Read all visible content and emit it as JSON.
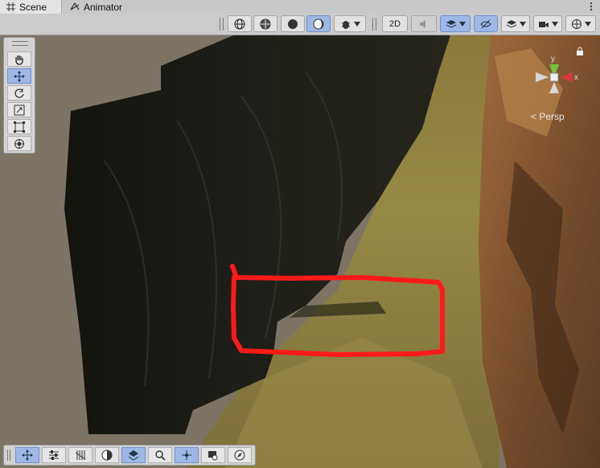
{
  "tabs": [
    {
      "label": "Scene",
      "icon": "grid-icon",
      "active": true
    },
    {
      "label": "Animator",
      "icon": "animator-icon",
      "active": false
    }
  ],
  "toolbar": {
    "mode_2d_label": "2D",
    "buttons": [
      "wireframe-globe-icon",
      "shaded-globe-icon",
      "shaded-circle-icon",
      "lighting-icon",
      "bug-icon",
      "2d-toggle",
      "audio-icon",
      "layers-icon",
      "visibility-icon",
      "layer-stack-icon",
      "camera-icon",
      "gizmo-icon"
    ]
  },
  "viewport": {
    "projection_label": "< Persp",
    "gizmo_axes": {
      "y": "y",
      "x": "x"
    },
    "annotation_color": "#ff1a1a"
  },
  "tools": [
    "hand-icon",
    "move-icon",
    "rotate-icon",
    "scale-icon",
    "rect-icon",
    "transform-icon"
  ],
  "bottom_tools": [
    "move-icon",
    "snap-settings-icon",
    "grid-snap-icon",
    "shading-icon",
    "navmesh-icon",
    "search-icon",
    "pivot-icon",
    "camera-view-icon",
    "compass-icon"
  ]
}
